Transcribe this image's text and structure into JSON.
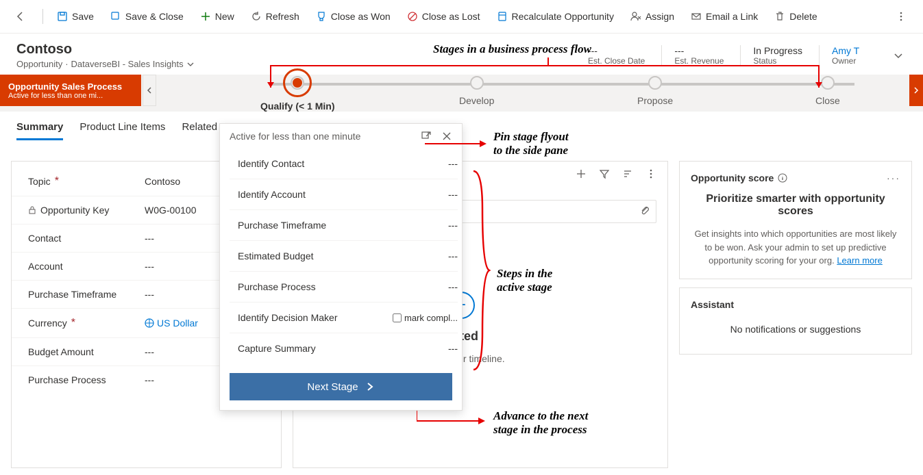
{
  "commandBar": {
    "save": "Save",
    "saveClose": "Save & Close",
    "new": "New",
    "refresh": "Refresh",
    "closeWon": "Close as Won",
    "closeLost": "Close as Lost",
    "recalc": "Recalculate Opportunity",
    "assign": "Assign",
    "emailLink": "Email a Link",
    "delete": "Delete"
  },
  "header": {
    "title": "Contoso",
    "entity": "Opportunity",
    "view": "DataverseBI - Sales Insights",
    "estCloseDate": {
      "val": "---",
      "lbl": "Est. Close Date"
    },
    "estRevenue": {
      "val": "---",
      "lbl": "Est. Revenue"
    },
    "status": {
      "val": "In Progress",
      "lbl": "Status"
    },
    "owner": {
      "val": "Amy T",
      "lbl": "Owner"
    }
  },
  "bpf": {
    "processName": "Opportunity Sales Process",
    "processSub": "Active for less than one mi...",
    "stages": [
      "Qualify  (< 1 Min)",
      "Develop",
      "Propose",
      "Close"
    ]
  },
  "tabs": [
    "Summary",
    "Product Line Items",
    "Related"
  ],
  "fields": {
    "topic": {
      "label": "Topic",
      "value": "Contoso"
    },
    "oppKey": {
      "label": "Opportunity Key",
      "value": "W0G-00100"
    },
    "contact": {
      "label": "Contact",
      "value": "---"
    },
    "account": {
      "label": "Account",
      "value": "---"
    },
    "purchaseTimeframe": {
      "label": "Purchase Timeframe",
      "value": "---"
    },
    "currency": {
      "label": "Currency",
      "value": "US Dollar"
    },
    "budgetAmount": {
      "label": "Budget Amount",
      "value": "---"
    },
    "purchaseProcess": {
      "label": "Purchase Process",
      "value": "---"
    }
  },
  "flyout": {
    "headerText": "Active for less than one minute",
    "steps": [
      {
        "label": "Identify Contact",
        "value": "---"
      },
      {
        "label": "Identify Account",
        "value": "---"
      },
      {
        "label": "Purchase Timeframe",
        "value": "---"
      },
      {
        "label": "Estimated Budget",
        "value": "---"
      },
      {
        "label": "Purchase Process",
        "value": "---"
      },
      {
        "label": "Identify Decision Maker",
        "checkbox": "mark compl..."
      },
      {
        "label": "Capture Summary",
        "value": "---"
      }
    ],
    "nextStageLabel": "Next Stage"
  },
  "timeline": {
    "startedHeading": "started",
    "hint": "records in your timeline."
  },
  "oppScore": {
    "title": "Opportunity score",
    "heading": "Prioritize smarter with opportunity scores",
    "body": "Get insights into which opportunities are most likely to be won. Ask your admin to set up predictive opportunity scoring for your org. ",
    "learnMore": "Learn more"
  },
  "assistant": {
    "title": "Assistant",
    "empty": "No notifications or suggestions"
  },
  "annotations": {
    "stages": "Stages in a business process flow",
    "pin": "Pin stage flyout\nto the side pane",
    "steps": "Steps in the\nactive stage",
    "advance": "Advance to the next\nstage in the process"
  }
}
